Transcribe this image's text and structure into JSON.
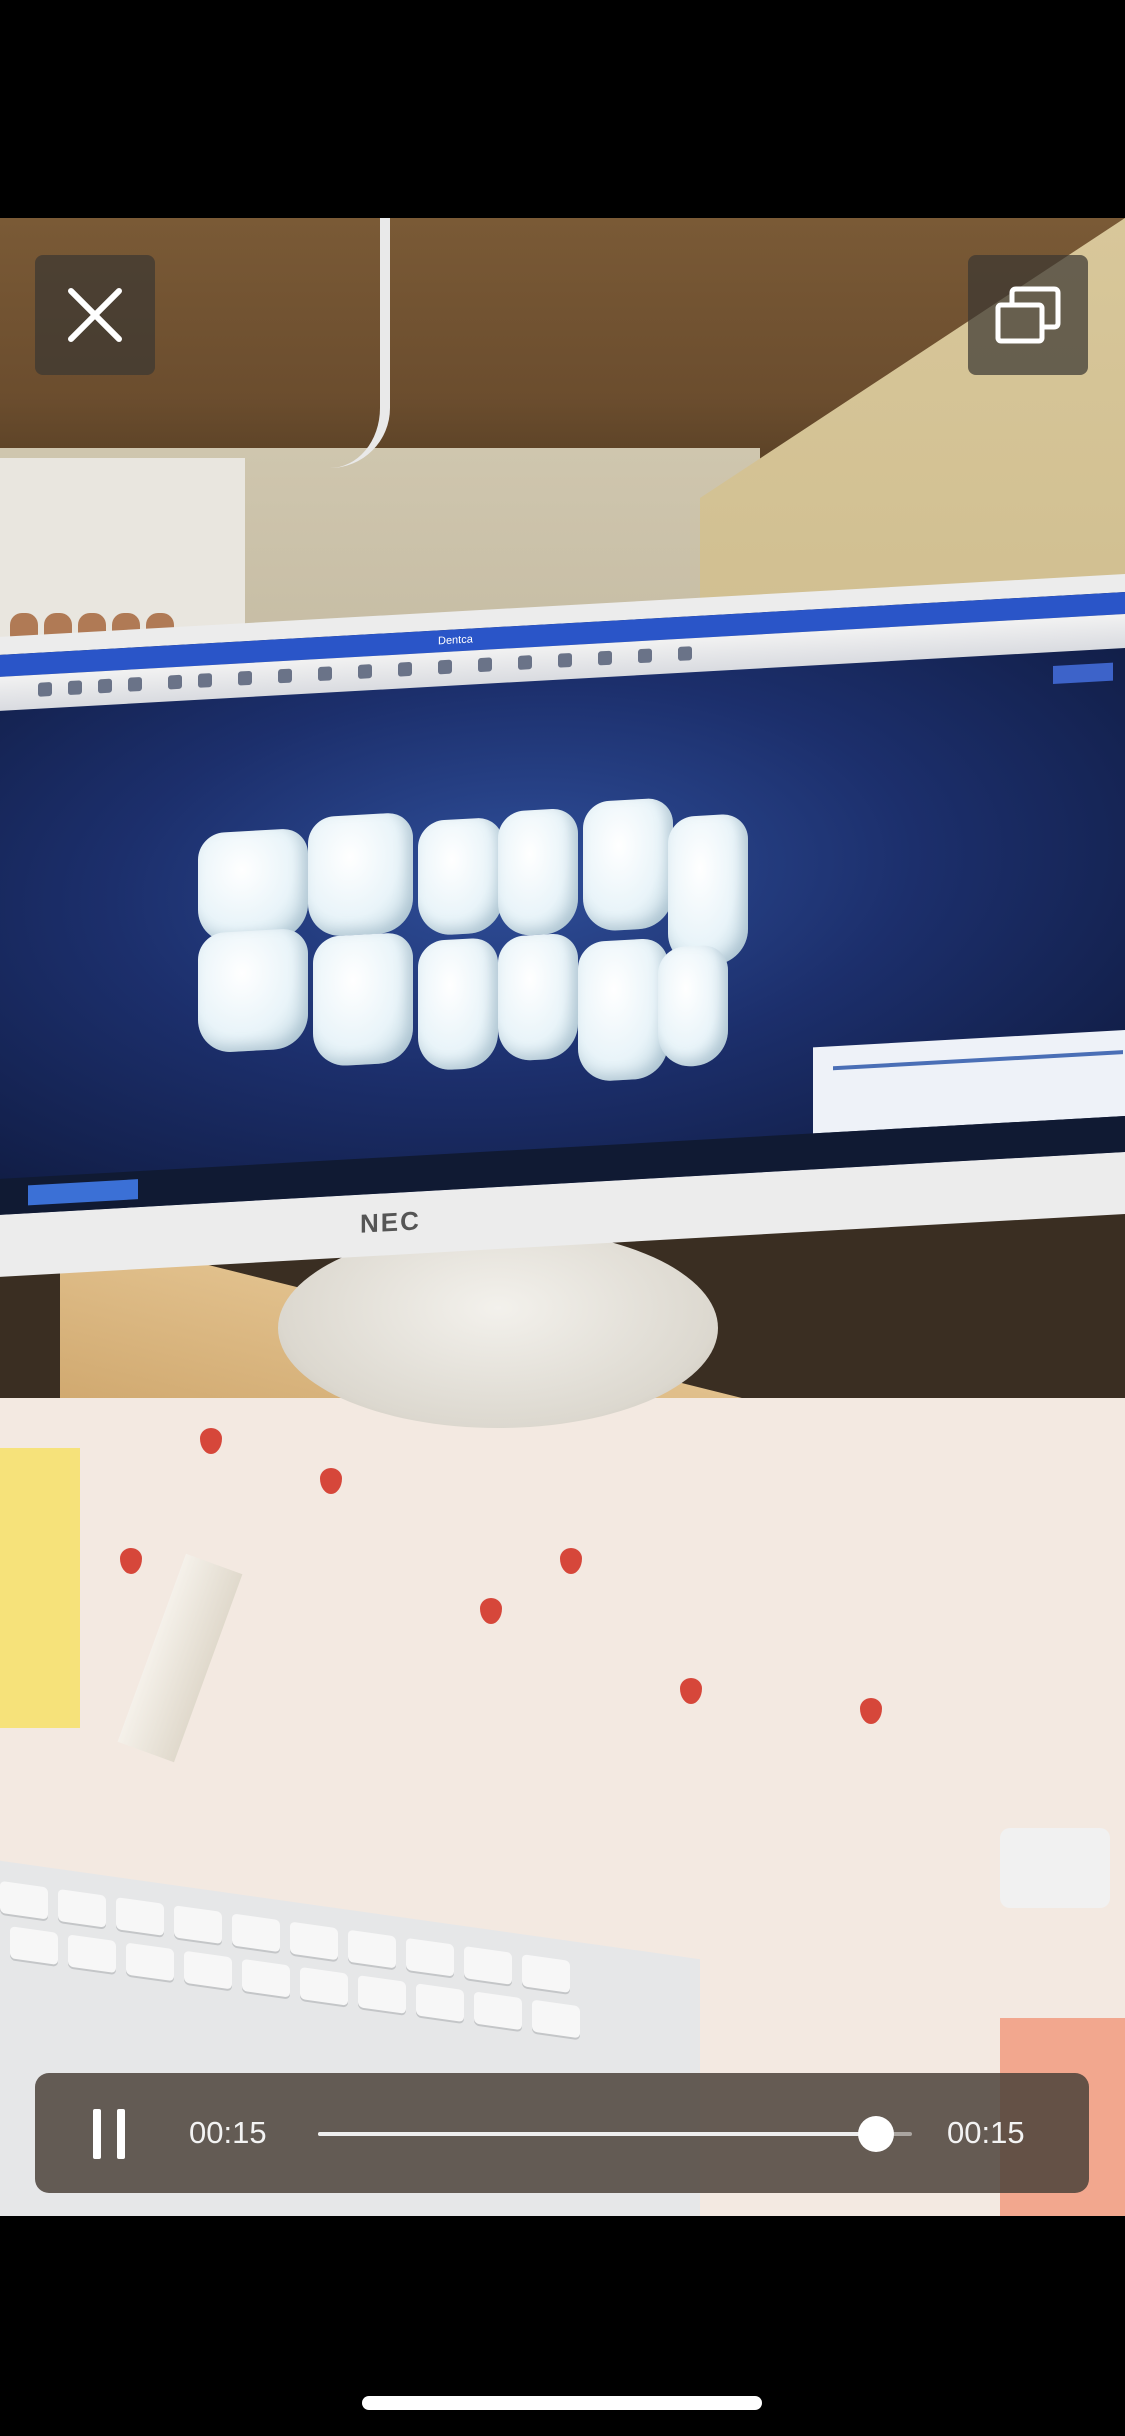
{
  "player": {
    "current_time": "00:15",
    "total_time": "00:15",
    "progress_fraction": 0.94,
    "state": "playing"
  },
  "controls": {
    "close_icon": "close-icon",
    "pip_icon": "picture-in-picture-icon",
    "pause_icon": "pause-icon"
  },
  "video_content": {
    "app_window_title": "Dentca",
    "monitor_brand": "NEC"
  },
  "colors": {
    "overlay_background": "#4b423a",
    "text": "#f3f3f3",
    "seek_fill": "#eeeeee"
  }
}
